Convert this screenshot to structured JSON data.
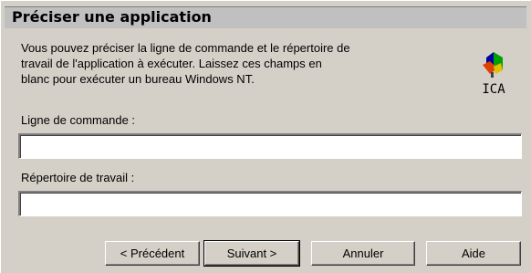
{
  "dialog": {
    "title": "Préciser une application",
    "description_line1": "Vous pouvez préciser la ligne de commande et le répertoire de",
    "description_line2": "travail de l'application à exécuter. Laissez ces champs en",
    "description_line3": "blanc pour exécuter un bureau Windows NT."
  },
  "fields": {
    "command_label": "Ligne de commande :",
    "command_value": "",
    "workdir_label": "Répertoire de travail :",
    "workdir_value": ""
  },
  "buttons": {
    "previous": "< Précédent",
    "next": "Suivant >",
    "cancel": "Annuler",
    "help": "Aide"
  },
  "logo": {
    "icon": "citrix-ica-icon",
    "text": "ICA"
  }
}
